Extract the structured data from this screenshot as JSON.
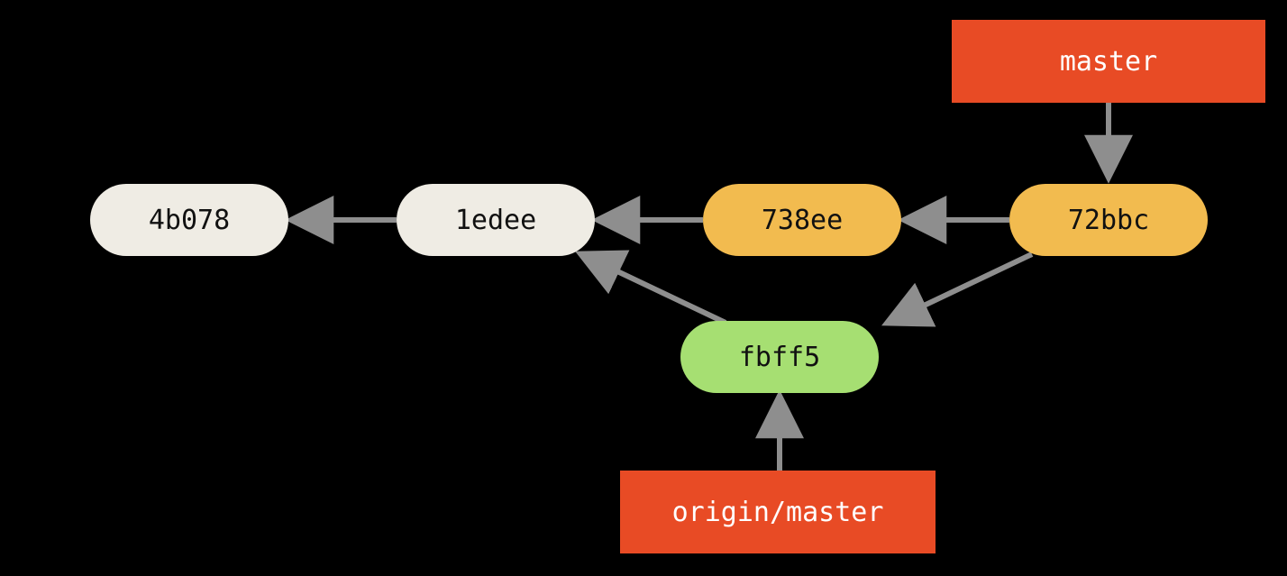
{
  "colors": {
    "arrow": "#8e8e8e",
    "refBg": "#e84b25",
    "creamCommit": "#efece4",
    "amberCommit": "#f2bb4f",
    "greenCommit": "#a6df72",
    "background": "#000000"
  },
  "refs": {
    "master": "master",
    "origin_master": "origin/master"
  },
  "commits": {
    "c1": "4b078",
    "c2": "1edee",
    "c3": "738ee",
    "c4": "72bbc",
    "c5": "fbff5"
  },
  "edges_description": [
    "master -> 72bbc",
    "72bbc -> 738ee",
    "738ee -> 1edee",
    "1edee -> 4b078",
    "72bbc -> fbff5",
    "fbff5 -> 1edee",
    "origin/master -> fbff5"
  ]
}
